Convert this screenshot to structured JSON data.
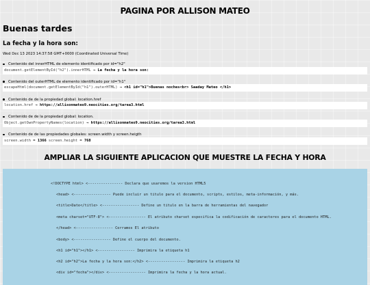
{
  "page_title": "PAGINA POR ALLISON MATEO",
  "greeting": "Buenas tardes",
  "subheading": "La fecha y la hora son:",
  "datetime": "Wed Dec 13 2023 14:37:58 GMT+0000 (Coordinated Universal Time)",
  "items": [
    {
      "description": "Contenido del innerHTML de elemento identificado por id=\"h2\"",
      "expression": "document.getElementById(\"h2\").innerHTML",
      "arrow": "→",
      "result": "La fecha y la hora son:"
    },
    {
      "description": "Contenido del outerHTML de elemento identificado por id=\"h1\"",
      "expression": "escapeHtml(document.getElementById(\"h1\").outerHTML)",
      "arrow": "→",
      "result": "<h1 id=\"h1\">Buenas noches<br> Saaday Mateo </h1>"
    },
    {
      "description": "Contenido de de la propiedad global: location.href",
      "expression": "location.href",
      "arrow": "→",
      "result": "https://allisonmateo9.neocities.org/tarea3.html"
    },
    {
      "description": "Contenido de de la propiedad global: location.",
      "expression": "Object.getOwnPropertyNames(location)",
      "arrow": "→",
      "result": "https://allisonmateo9.neocities.org/tarea3.html"
    },
    {
      "description": "Contenido de de las propiedades globales: screen.width y screen.heigth",
      "expression_parts": [
        {
          "text": "screen.width",
          "kind": "expr"
        },
        {
          "text": " = ",
          "kind": "sep"
        },
        {
          "text": "1366",
          "kind": "result"
        },
        {
          "text": " screen.height",
          "kind": "expr"
        },
        {
          "text": " = ",
          "kind": "sep"
        },
        {
          "text": "768",
          "kind": "result"
        }
      ]
    }
  ],
  "section_heading": "AMPLIAR LA SIGUIENTE APLICACION QUE MUESTRE LA FECHA Y HORA",
  "code_lines": [
    "<!DOCTYPE html>      <----------------  Declara que usaremos la version HTML5",
    "<head>      <----------------- Puede incluir un titulo para el documento, scripts, estilos, meta-información, y más.",
    "<title>Date</title>       <----------------- Define un titulo en la barra de herramientas del navegador",
    "<meta charset=\"UTF-8\">  <----------------- El atributo charset especifica la codificación de caracteres para el documento HTML.",
    "</head>     <-----------------  Cerramos El atributo",
    "<body>     <----------------- Define el cuerpo del documento.",
    "<h1 id=\"h1\"></h1> <----------------- Imprimira la etiqueta h1",
    "<h2 id=\"h2\">La fecha y la hora son:</h2> <----------------- Imprimira la etiqueta h2",
    "<div id=\"fecha\"></div> <----------------- Imprimira la fecha y la hora actual."
  ]
}
